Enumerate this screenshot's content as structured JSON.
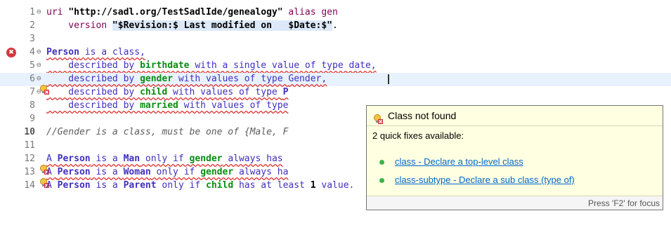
{
  "editor": {
    "lines": [
      {
        "num": "1"
      },
      {
        "num": "2"
      },
      {
        "num": "3"
      },
      {
        "num": "4"
      },
      {
        "num": "5"
      },
      {
        "num": "6"
      },
      {
        "num": "7"
      },
      {
        "num": "8"
      },
      {
        "num": "9"
      },
      {
        "num": "10"
      },
      {
        "num": "11"
      },
      {
        "num": "12"
      },
      {
        "num": "13"
      },
      {
        "num": "14"
      }
    ],
    "fold_glyph": "⊖",
    "l1": {
      "a": "uri ",
      "b": "\"http://sadl.org/TestSadlIde/genealogy\"",
      "c": " alias gen"
    },
    "l2": {
      "a": "    version ",
      "b": "\"$Revision:$ Last modified on   $Date:$\"",
      "c": "."
    },
    "l4": {
      "a": "Person",
      "b": " is a class,"
    },
    "l5": {
      "a": "    described by ",
      "b": "birthdate",
      "c": " with a single value of type date,"
    },
    "l6": {
      "a": "    described by ",
      "b": "gender",
      "c": " with values of type ",
      "d": "Gender",
      "e": ","
    },
    "l7": {
      "a": "    described by ",
      "b": "child",
      "c": " with values of type ",
      "d": "P"
    },
    "l8": {
      "a": "    described by ",
      "b": "married",
      "c": " with values of type"
    },
    "l10": {
      "a": "//Gender is a class, must be one of {Male, F"
    },
    "l12": {
      "a": "A ",
      "b": "Person",
      "c": " is a ",
      "d": "Man",
      "e": " only if ",
      "f": "gender",
      "g": " always has"
    },
    "l13": {
      "a": "A ",
      "b": "Person",
      "c": " is a ",
      "d": "Woman",
      "e": " only if ",
      "f": "gender",
      "g": " always ha"
    },
    "l14": {
      "a": "A ",
      "b": "Person",
      "c": " is a ",
      "d": "Parent",
      "e": " only if ",
      "f": "child",
      "g": " has at least ",
      "h": "1",
      "i": " value."
    },
    "gutter": {
      "error_glyph": "✖"
    }
  },
  "popup": {
    "title": "Class not found",
    "subtitle": "2 quick fixes available:",
    "fixes": [
      {
        "label": "class - Declare a top-level class"
      },
      {
        "label": "class-subtype - Declare a sub class (type of)"
      }
    ],
    "footer": "Press 'F2' for focus"
  },
  "icons": {
    "error": "error-icon",
    "lightbulb_error": "lightbulb-error-icon",
    "fix_bullet": "green-dot-icon"
  }
}
